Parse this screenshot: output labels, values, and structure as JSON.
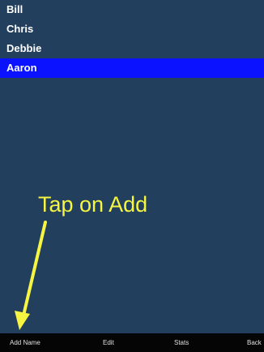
{
  "names": [
    {
      "label": "Bill",
      "selected": false
    },
    {
      "label": "Chris",
      "selected": false
    },
    {
      "label": "Debbie",
      "selected": false
    },
    {
      "label": "Aaron",
      "selected": true
    }
  ],
  "hint": {
    "text": "Tap on Add",
    "icon": "arrow-down-left-icon",
    "color": "#f5f542"
  },
  "toolbar": {
    "add_name_label": "Add Name",
    "edit_label": "Edit",
    "stats_label": "Stats",
    "back_label": "Back"
  },
  "colors": {
    "background": "#22405d",
    "selection": "#0a12ff",
    "toolbar": "#050505"
  }
}
